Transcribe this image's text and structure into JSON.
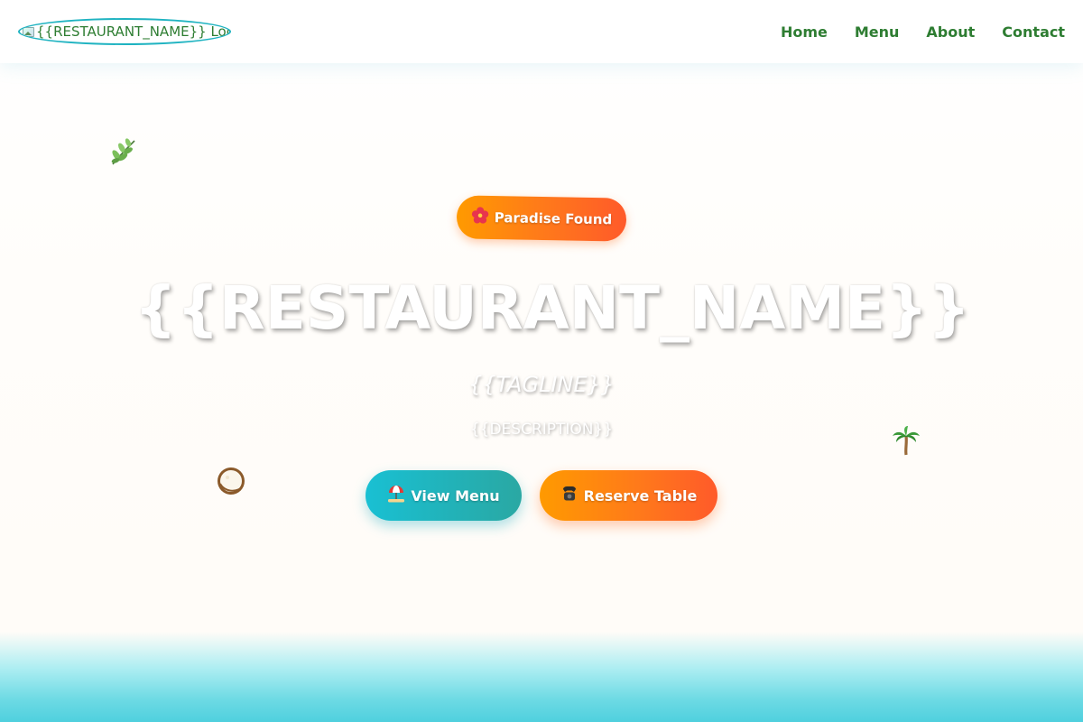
{
  "header": {
    "logo_alt": "{{RESTAURANT_NAME}} Logo",
    "nav": [
      {
        "label": "Home"
      },
      {
        "label": "Menu"
      },
      {
        "label": "About"
      },
      {
        "label": "Contact"
      }
    ]
  },
  "hero": {
    "badge": {
      "icon": "hibiscus-icon",
      "label": "Paradise Found"
    },
    "title": "{{RESTAURANT_NAME}}",
    "tagline": "{{TAGLINE}}",
    "description": "{{DESCRIPTION}}",
    "buttons": [
      {
        "icon": "beach-umbrella-icon",
        "label": "View Menu"
      },
      {
        "icon": "phone-icon",
        "label": "Reserve Table"
      }
    ],
    "decorations": [
      "leaf-icon",
      "palm-tree-icon",
      "coconut-icon"
    ]
  },
  "colors": {
    "brand_green": "#2e7d32",
    "accent_teal": "#1fb3c1",
    "accent_orange": "#ff7a1a",
    "sea": "#4fd0de"
  }
}
